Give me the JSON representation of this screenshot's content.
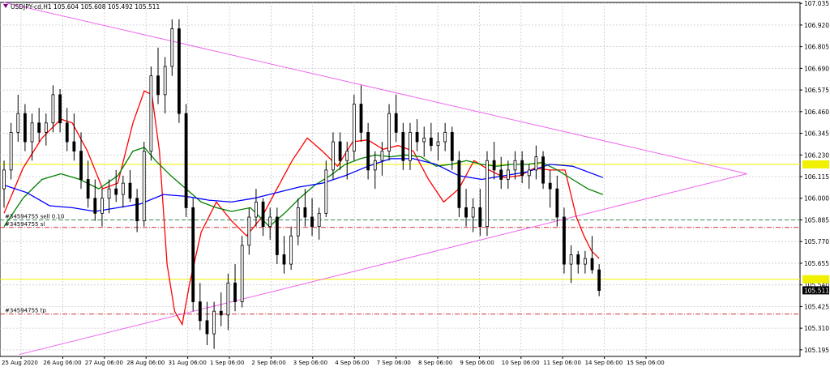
{
  "window": {
    "symbol_line": "USDJPY-cd,H1  105.604 105.608 105.492 105.511"
  },
  "colors": {
    "background": "#ffffff",
    "grid": "#c8c8c8",
    "candle": "#000000",
    "ma_fast": "#ff0000",
    "ma_mid": "#008000",
    "ma_slow": "#0000ff",
    "trendline": "#ee66ee",
    "horizontal_level": "#f0f000",
    "sell_line": "#2e8b57",
    "sl_tp_line": "#cc3333",
    "price_tag_bg": "#000000",
    "price_tag_text": "#ffffff"
  },
  "labels": {
    "sell_order": "#34594755 sell 0.10",
    "stop_loss": "#34594755 sl",
    "take_profit": "#34594755 tp",
    "current_price": "105.511"
  },
  "chart_data": {
    "type": "candlestick",
    "title": "USDJPY-cd,H1",
    "ohlc_header": {
      "open": 105.604,
      "high": 105.608,
      "low": 105.492,
      "close": 105.511
    },
    "ylim": [
      105.16,
      107.04
    ],
    "y_ticks": [
      107.035,
      106.92,
      106.805,
      106.69,
      106.575,
      106.46,
      106.345,
      106.23,
      106.115,
      106.0,
      105.885,
      105.77,
      105.655,
      105.54,
      105.425,
      105.31,
      105.195
    ],
    "x_ticks": [
      "25 Aug 2020",
      "26 Aug 06:00",
      "27 Aug 06:00",
      "28 Aug 06:00",
      "31 Aug 06:00",
      "1 Sep 06:00",
      "2 Sep 06:00",
      "3 Sep 06:00",
      "4 Sep 06:00",
      "7 Sep 06:00",
      "8 Sep 06:00",
      "9 Sep 06:00",
      "10 Sep 06:00",
      "11 Sep 06:00",
      "14 Sep 06:00",
      "15 Sep 06:00"
    ],
    "grid": true,
    "levels": {
      "upper_horizontal": 106.18,
      "lower_horizontal": 105.57,
      "sell_entry": 105.885,
      "stop_loss": 105.845,
      "take_profit": 105.385,
      "current_price": 105.511
    },
    "trendlines": [
      {
        "name": "upper",
        "from": [
          0,
          107.04
        ],
        "to": [
          196,
          106.13
        ]
      },
      {
        "name": "lower",
        "from": [
          4,
          105.17
        ],
        "to": [
          196,
          106.13
        ]
      }
    ],
    "moving_averages": [
      {
        "color": "ma_fast",
        "points": [
          [
            0,
            105.92
          ],
          [
            5,
            106.16
          ],
          [
            10,
            106.32
          ],
          [
            15,
            106.42
          ],
          [
            18,
            106.4
          ],
          [
            22,
            106.25
          ],
          [
            26,
            106.05
          ],
          [
            30,
            106.08
          ],
          [
            34,
            106.4
          ],
          [
            37,
            106.57
          ],
          [
            39,
            106.55
          ],
          [
            41,
            106.25
          ],
          [
            43,
            105.65
          ],
          [
            45,
            105.4
          ],
          [
            47,
            105.33
          ],
          [
            49,
            105.55
          ],
          [
            52,
            105.82
          ],
          [
            56,
            105.98
          ],
          [
            60,
            105.88
          ],
          [
            64,
            105.8
          ],
          [
            68,
            105.9
          ],
          [
            72,
            106.05
          ],
          [
            76,
            106.2
          ],
          [
            80,
            106.32
          ],
          [
            84,
            106.25
          ],
          [
            88,
            106.17
          ],
          [
            92,
            106.3
          ],
          [
            96,
            106.31
          ],
          [
            100,
            106.26
          ],
          [
            104,
            106.28
          ],
          [
            108,
            106.25
          ],
          [
            112,
            106.1
          ],
          [
            116,
            105.98
          ],
          [
            120,
            106.05
          ],
          [
            124,
            106.2
          ],
          [
            128,
            106.15
          ],
          [
            132,
            106.11
          ],
          [
            136,
            106.12
          ],
          [
            140,
            106.16
          ],
          [
            144,
            106.15
          ],
          [
            148,
            106.15
          ],
          [
            151,
            105.9
          ],
          [
            153,
            105.8
          ],
          [
            155,
            105.72
          ],
          [
            157,
            105.68
          ]
        ]
      },
      {
        "color": "ma_mid",
        "points": [
          [
            0,
            105.85
          ],
          [
            5,
            106.0
          ],
          [
            10,
            106.1
          ],
          [
            15,
            106.13
          ],
          [
            20,
            106.1
          ],
          [
            25,
            106.05
          ],
          [
            30,
            106.12
          ],
          [
            34,
            106.25
          ],
          [
            37,
            106.27
          ],
          [
            40,
            106.2
          ],
          [
            44,
            106.12
          ],
          [
            48,
            106.05
          ],
          [
            52,
            105.98
          ],
          [
            56,
            105.95
          ],
          [
            60,
            105.93
          ],
          [
            65,
            105.95
          ],
          [
            70,
            105.85
          ],
          [
            74,
            105.92
          ],
          [
            78,
            106.0
          ],
          [
            82,
            106.07
          ],
          [
            86,
            106.12
          ],
          [
            90,
            106.18
          ],
          [
            94,
            106.21
          ],
          [
            98,
            106.23
          ],
          [
            102,
            106.22
          ],
          [
            106,
            106.23
          ],
          [
            110,
            106.22
          ],
          [
            114,
            106.17
          ],
          [
            118,
            106.18
          ],
          [
            122,
            106.2
          ],
          [
            126,
            106.18
          ],
          [
            130,
            106.17
          ],
          [
            134,
            106.18
          ],
          [
            138,
            106.18
          ],
          [
            142,
            106.19
          ],
          [
            146,
            106.15
          ],
          [
            150,
            106.1
          ],
          [
            154,
            106.05
          ],
          [
            158,
            106.02
          ]
        ]
      },
      {
        "color": "ma_slow",
        "points": [
          [
            0,
            106.07
          ],
          [
            6,
            106.03
          ],
          [
            12,
            105.96
          ],
          [
            18,
            105.95
          ],
          [
            24,
            105.93
          ],
          [
            30,
            105.95
          ],
          [
            36,
            105.97
          ],
          [
            42,
            106.02
          ],
          [
            48,
            106.01
          ],
          [
            54,
            105.99
          ],
          [
            60,
            105.98
          ],
          [
            66,
            106.0
          ],
          [
            72,
            106.03
          ],
          [
            78,
            106.06
          ],
          [
            84,
            106.08
          ],
          [
            90,
            106.12
          ],
          [
            96,
            106.17
          ],
          [
            102,
            106.21
          ],
          [
            108,
            106.21
          ],
          [
            114,
            106.18
          ],
          [
            120,
            106.12
          ],
          [
            126,
            106.1
          ],
          [
            132,
            106.12
          ],
          [
            138,
            106.14
          ],
          [
            144,
            106.18
          ],
          [
            150,
            106.17
          ],
          [
            158,
            106.11
          ]
        ]
      }
    ],
    "candles": [
      [
        106.05,
        106.2,
        105.95,
        106.15
      ],
      [
        106.15,
        106.4,
        106.1,
        106.35
      ],
      [
        106.35,
        106.55,
        106.3,
        106.45
      ],
      [
        106.45,
        106.5,
        106.25,
        106.3
      ],
      [
        106.3,
        106.45,
        106.2,
        106.4
      ],
      [
        106.4,
        106.48,
        106.3,
        106.35
      ],
      [
        106.35,
        106.45,
        106.28,
        106.4
      ],
      [
        106.4,
        106.6,
        106.35,
        106.55
      ],
      [
        106.55,
        106.58,
        106.35,
        106.4
      ],
      [
        106.4,
        106.48,
        106.25,
        106.3
      ],
      [
        106.3,
        106.45,
        106.2,
        106.25
      ],
      [
        106.25,
        106.35,
        106.05,
        106.1
      ],
      [
        106.1,
        106.2,
        105.95,
        106.0
      ],
      [
        106.0,
        106.1,
        105.88,
        105.92
      ],
      [
        105.92,
        106.05,
        105.85,
        106.0
      ],
      [
        106.0,
        106.1,
        105.92,
        106.05
      ],
      [
        106.05,
        106.15,
        105.98,
        106.02
      ],
      [
        106.02,
        106.12,
        105.95,
        106.08
      ],
      [
        106.08,
        106.15,
        105.98,
        106.0
      ],
      [
        106.0,
        106.05,
        105.82,
        105.88
      ],
      [
        105.88,
        106.3,
        105.85,
        106.25
      ],
      [
        106.25,
        106.7,
        106.2,
        106.65
      ],
      [
        106.65,
        106.8,
        106.5,
        106.55
      ],
      [
        106.55,
        106.75,
        106.45,
        106.7
      ],
      [
        106.7,
        106.95,
        106.65,
        106.9
      ],
      [
        106.9,
        106.95,
        106.4,
        106.45
      ],
      [
        106.45,
        106.5,
        105.9,
        105.95
      ],
      [
        105.95,
        106.0,
        105.4,
        105.45
      ],
      [
        105.45,
        105.55,
        105.3,
        105.35
      ],
      [
        105.35,
        105.45,
        105.22,
        105.28
      ],
      [
        105.28,
        105.45,
        105.2,
        105.4
      ],
      [
        105.4,
        105.5,
        105.32,
        105.38
      ],
      [
        105.38,
        105.6,
        105.3,
        105.55
      ],
      [
        105.55,
        105.65,
        105.4,
        105.45
      ],
      [
        105.45,
        105.8,
        105.42,
        105.75
      ],
      [
        105.75,
        105.95,
        105.7,
        105.9
      ],
      [
        105.9,
        106.05,
        105.85,
        105.98
      ],
      [
        105.98,
        106.0,
        105.8,
        105.85
      ],
      [
        105.85,
        105.95,
        105.78,
        105.9
      ],
      [
        105.9,
        105.95,
        105.65,
        105.7
      ],
      [
        105.7,
        105.8,
        105.6,
        105.65
      ],
      [
        105.65,
        105.85,
        105.62,
        105.8
      ],
      [
        105.8,
        106.0,
        105.75,
        105.95
      ],
      [
        105.95,
        106.05,
        105.85,
        105.9
      ],
      [
        105.9,
        106.0,
        105.8,
        105.85
      ],
      [
        105.85,
        105.95,
        105.78,
        105.92
      ],
      [
        105.92,
        106.2,
        105.9,
        106.15
      ],
      [
        106.15,
        106.35,
        106.1,
        106.3
      ],
      [
        106.3,
        106.35,
        106.15,
        106.2
      ],
      [
        106.2,
        106.3,
        106.1,
        106.25
      ],
      [
        106.25,
        106.55,
        106.2,
        106.5
      ],
      [
        106.5,
        106.6,
        106.3,
        106.35
      ],
      [
        106.35,
        106.4,
        106.1,
        106.15
      ],
      [
        106.15,
        106.25,
        106.05,
        106.2
      ],
      [
        106.2,
        106.3,
        106.12,
        106.25
      ],
      [
        106.25,
        106.5,
        106.2,
        106.45
      ],
      [
        106.45,
        106.55,
        106.3,
        106.35
      ],
      [
        106.35,
        106.4,
        106.15,
        106.2
      ],
      [
        106.2,
        106.4,
        106.15,
        106.35
      ],
      [
        106.35,
        106.42,
        106.25,
        106.3
      ],
      [
        106.3,
        106.38,
        106.22,
        106.32
      ],
      [
        106.32,
        106.4,
        106.25,
        106.28
      ],
      [
        106.28,
        106.35,
        106.2,
        106.3
      ],
      [
        106.3,
        106.4,
        106.25,
        106.35
      ],
      [
        106.35,
        106.38,
        106.15,
        106.2
      ],
      [
        106.2,
        106.25,
        105.9,
        105.95
      ],
      [
        105.95,
        106.05,
        105.85,
        105.9
      ],
      [
        105.9,
        106.0,
        105.82,
        105.95
      ],
      [
        105.95,
        106.05,
        105.8,
        105.85
      ],
      [
        105.85,
        106.25,
        105.8,
        106.2
      ],
      [
        106.2,
        106.3,
        106.1,
        106.15
      ],
      [
        106.15,
        106.22,
        106.05,
        106.1
      ],
      [
        106.1,
        106.2,
        106.05,
        106.15
      ],
      [
        106.15,
        106.25,
        106.1,
        106.2
      ],
      [
        106.2,
        106.25,
        106.08,
        106.12
      ],
      [
        106.12,
        106.18,
        106.05,
        106.15
      ],
      [
        106.15,
        106.28,
        106.1,
        106.22
      ],
      [
        106.22,
        106.25,
        106.05,
        106.08
      ],
      [
        106.08,
        106.15,
        105.95,
        106.05
      ],
      [
        106.05,
        106.12,
        105.85,
        105.9
      ],
      [
        105.9,
        105.95,
        105.6,
        105.65
      ],
      [
        105.65,
        105.75,
        105.55,
        105.7
      ],
      [
        105.7,
        105.72,
        105.6,
        105.65
      ],
      [
        105.65,
        105.72,
        105.6,
        105.68
      ],
      [
        105.68,
        105.8,
        105.6,
        105.62
      ],
      [
        105.62,
        105.65,
        105.48,
        105.51
      ]
    ],
    "candle_count": 86,
    "x_domain": [
      0,
      210
    ]
  }
}
